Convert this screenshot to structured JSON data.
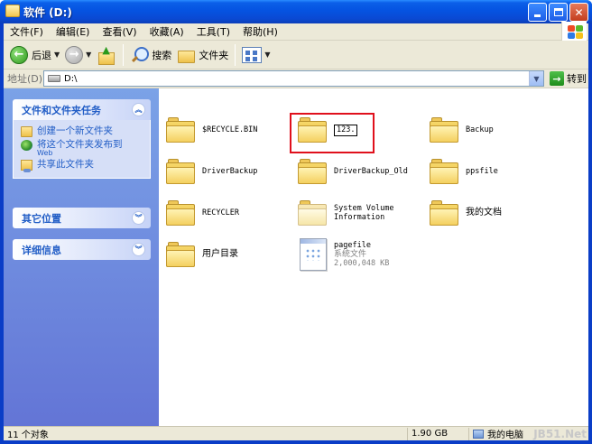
{
  "window": {
    "title": "软件 (D:)"
  },
  "menubar": {
    "items": [
      "文件(F)",
      "编辑(E)",
      "查看(V)",
      "收藏(A)",
      "工具(T)",
      "帮助(H)"
    ]
  },
  "toolbar": {
    "back_label": "后退",
    "search_label": "搜索",
    "folders_label": "文件夹"
  },
  "address": {
    "label": "地址(D)",
    "value": "D:\\",
    "go_label": "转到"
  },
  "taskpane": {
    "file_tasks_title": "文件和文件夹任务",
    "tasks": [
      {
        "label": "创建一个新文件夹",
        "icon": "new-folder-icon"
      },
      {
        "label": "将这个文件夹发布到",
        "sub": "Web",
        "icon": "publish-web-icon"
      },
      {
        "label": "共享此文件夹",
        "icon": "share-folder-icon"
      }
    ],
    "other_places_title": "其它位置",
    "details_title": "详细信息"
  },
  "files": [
    {
      "name": "$RECYCLE.BIN",
      "type": "folder"
    },
    {
      "name": "123.",
      "type": "folder",
      "renaming": true
    },
    {
      "name": "Backup",
      "type": "folder"
    },
    {
      "name": "DriverBackup",
      "type": "folder"
    },
    {
      "name": "DriverBackup_Old",
      "type": "folder"
    },
    {
      "name": "ppsfile",
      "type": "folder"
    },
    {
      "name": "RECYCLER",
      "type": "folder"
    },
    {
      "name": "System Volume",
      "name2": "Information",
      "type": "folder",
      "pale": true
    },
    {
      "name": "我的文档",
      "type": "folder"
    },
    {
      "name": "用户目录",
      "type": "folder"
    },
    {
      "name": "pagefile",
      "kind": "系统文件",
      "size": "2,000,048 KB",
      "type": "system-file"
    }
  ],
  "status": {
    "count": "11 个对象",
    "size": "1.90 GB",
    "location": "我的电脑",
    "watermark": "JB51.Net"
  }
}
